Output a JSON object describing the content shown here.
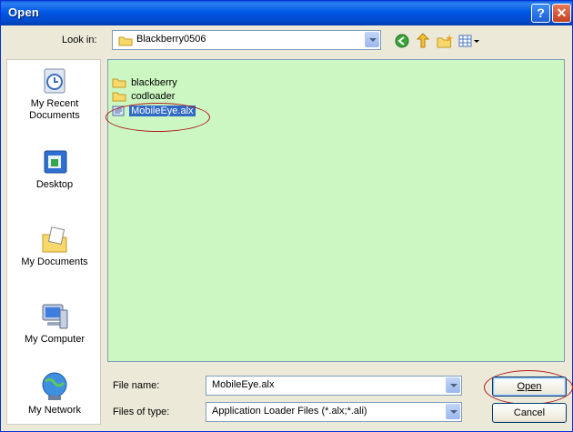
{
  "window": {
    "title": "Open",
    "help_label": "?",
    "close_label": "✕"
  },
  "lookin": {
    "label": "Look in:",
    "value": "Blackberry0506"
  },
  "places": [
    {
      "label": "My Recent\nDocuments",
      "icon": "recent-documents-icon"
    },
    {
      "label": "Desktop",
      "icon": "desktop-icon"
    },
    {
      "label": "My Documents",
      "icon": "my-documents-icon"
    },
    {
      "label": "My Computer",
      "icon": "my-computer-icon"
    },
    {
      "label": "My Network",
      "icon": "my-network-icon"
    }
  ],
  "files": [
    {
      "name": "blackberry",
      "type": "folder"
    },
    {
      "name": "codloader",
      "type": "folder"
    },
    {
      "name": "MobileEye.alx",
      "type": "file",
      "selected": true
    }
  ],
  "filename": {
    "label": "File name:",
    "value": "MobileEye.alx"
  },
  "filetype": {
    "label": "Files of type:",
    "value": "Application Loader Files (*.alx;*.ali)"
  },
  "buttons": {
    "open": "Open",
    "cancel": "Cancel"
  },
  "colors": {
    "list_background": "#ccf7c2",
    "selection": "#316ac5",
    "annotation": "#b01919"
  }
}
